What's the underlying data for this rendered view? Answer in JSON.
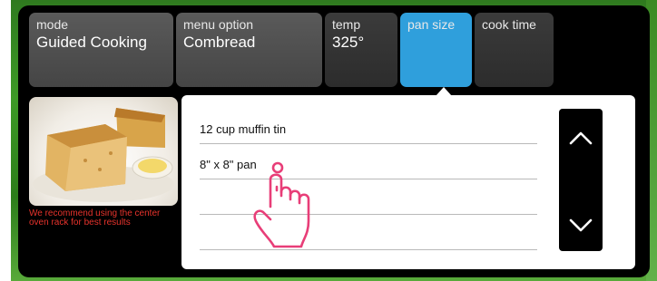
{
  "tabs": [
    {
      "label": "mode",
      "value": "Guided Cooking"
    },
    {
      "label": "menu option",
      "value": "Combread"
    },
    {
      "label": "temp",
      "value": "325°"
    },
    {
      "label": "pan size",
      "value": ""
    },
    {
      "label": "cook time",
      "value": ""
    }
  ],
  "active_tab": "pan size",
  "recommendation": "We recommend using the center oven rack for best results",
  "pan_options": [
    "12 cup muffin tin",
    "8\" x 8\" pan",
    "",
    ""
  ],
  "scroll": {
    "up_icon": "chevron-up-icon",
    "down_icon": "chevron-down-icon"
  },
  "image": {
    "name": "cornbread-photo"
  },
  "colors": {
    "active_tab": "#2f9fdc",
    "warning_text": "#e8332c",
    "hand_outline": "#e83e78"
  }
}
